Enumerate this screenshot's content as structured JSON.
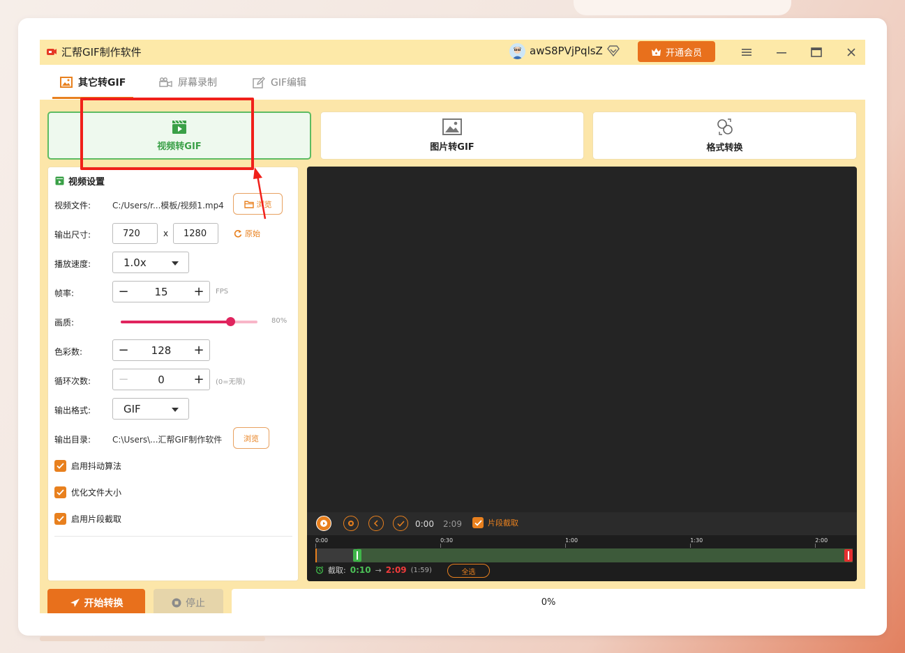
{
  "app": {
    "title": "汇帮GIF制作软件",
    "username": "awS8PVjPqlsZ",
    "vip_label": "开通会员"
  },
  "tabs": [
    {
      "label": "其它转GIF",
      "active": true
    },
    {
      "label": "屏幕录制",
      "active": false
    },
    {
      "label": "GIF编辑",
      "active": false
    }
  ],
  "modes": [
    {
      "label": "视频转GIF",
      "icon": "video-clapper-icon",
      "active": true
    },
    {
      "label": "图片转GIF",
      "icon": "image-icon",
      "active": false
    },
    {
      "label": "格式转换",
      "icon": "convert-icon",
      "active": false
    }
  ],
  "settings": {
    "title": "视频设置",
    "video_file_label": "视频文件:",
    "video_file_path": "C:/Users/r...模板/视频1.mp4",
    "browse_label": "浏览",
    "output_size_label": "输出尺寸:",
    "width": "720",
    "height": "1280",
    "x_sign": "x",
    "original_label": "原始",
    "speed_label": "播放速度:",
    "speed_value": "1.0x",
    "fps_label": "帧率:",
    "fps_value": "15",
    "fps_unit": "FPS",
    "quality_label": "画质:",
    "quality_value": 80,
    "quality_text": "80%",
    "colors_label": "色彩数:",
    "colors_value": "128",
    "loop_label": "循环次数:",
    "loop_value": "0",
    "loop_hint": "(0=无限)",
    "format_label": "输出格式:",
    "format_value": "GIF",
    "output_dir_label": "输出目录:",
    "output_dir_path": "C:\\Users\\...汇帮GIF制作软件",
    "output_browse_label": "浏览",
    "checkboxes": [
      {
        "label": "启用抖动算法",
        "checked": true
      },
      {
        "label": "优化文件大小",
        "checked": true
      },
      {
        "label": "启用片段截取",
        "checked": true
      }
    ]
  },
  "player": {
    "current_time": "0:00",
    "duration": "2:09",
    "segment_label": "片段截取",
    "segment_checked": true
  },
  "timeline": {
    "ticks": [
      "0:00",
      "0:30",
      "1:00",
      "1:30",
      "2:00"
    ],
    "tick_seconds": [
      0,
      30,
      60,
      90,
      120
    ],
    "duration_seconds": 129,
    "clip_start_seconds": 10,
    "clip_end_seconds": 129,
    "clip_label": "截取:",
    "clip_start": "0:10",
    "clip_arrow": "→",
    "clip_end": "2:09",
    "clip_length": "(1:59)",
    "select_all_label": "全选"
  },
  "bottom": {
    "start_label": "开始转换",
    "stop_label": "停止",
    "progress_text": "0%",
    "progress_value": 0
  },
  "colors": {
    "accent": "#e8801e",
    "active_green": "#3aa047",
    "annotation": "#f0201a",
    "slider": "#e0245e"
  }
}
